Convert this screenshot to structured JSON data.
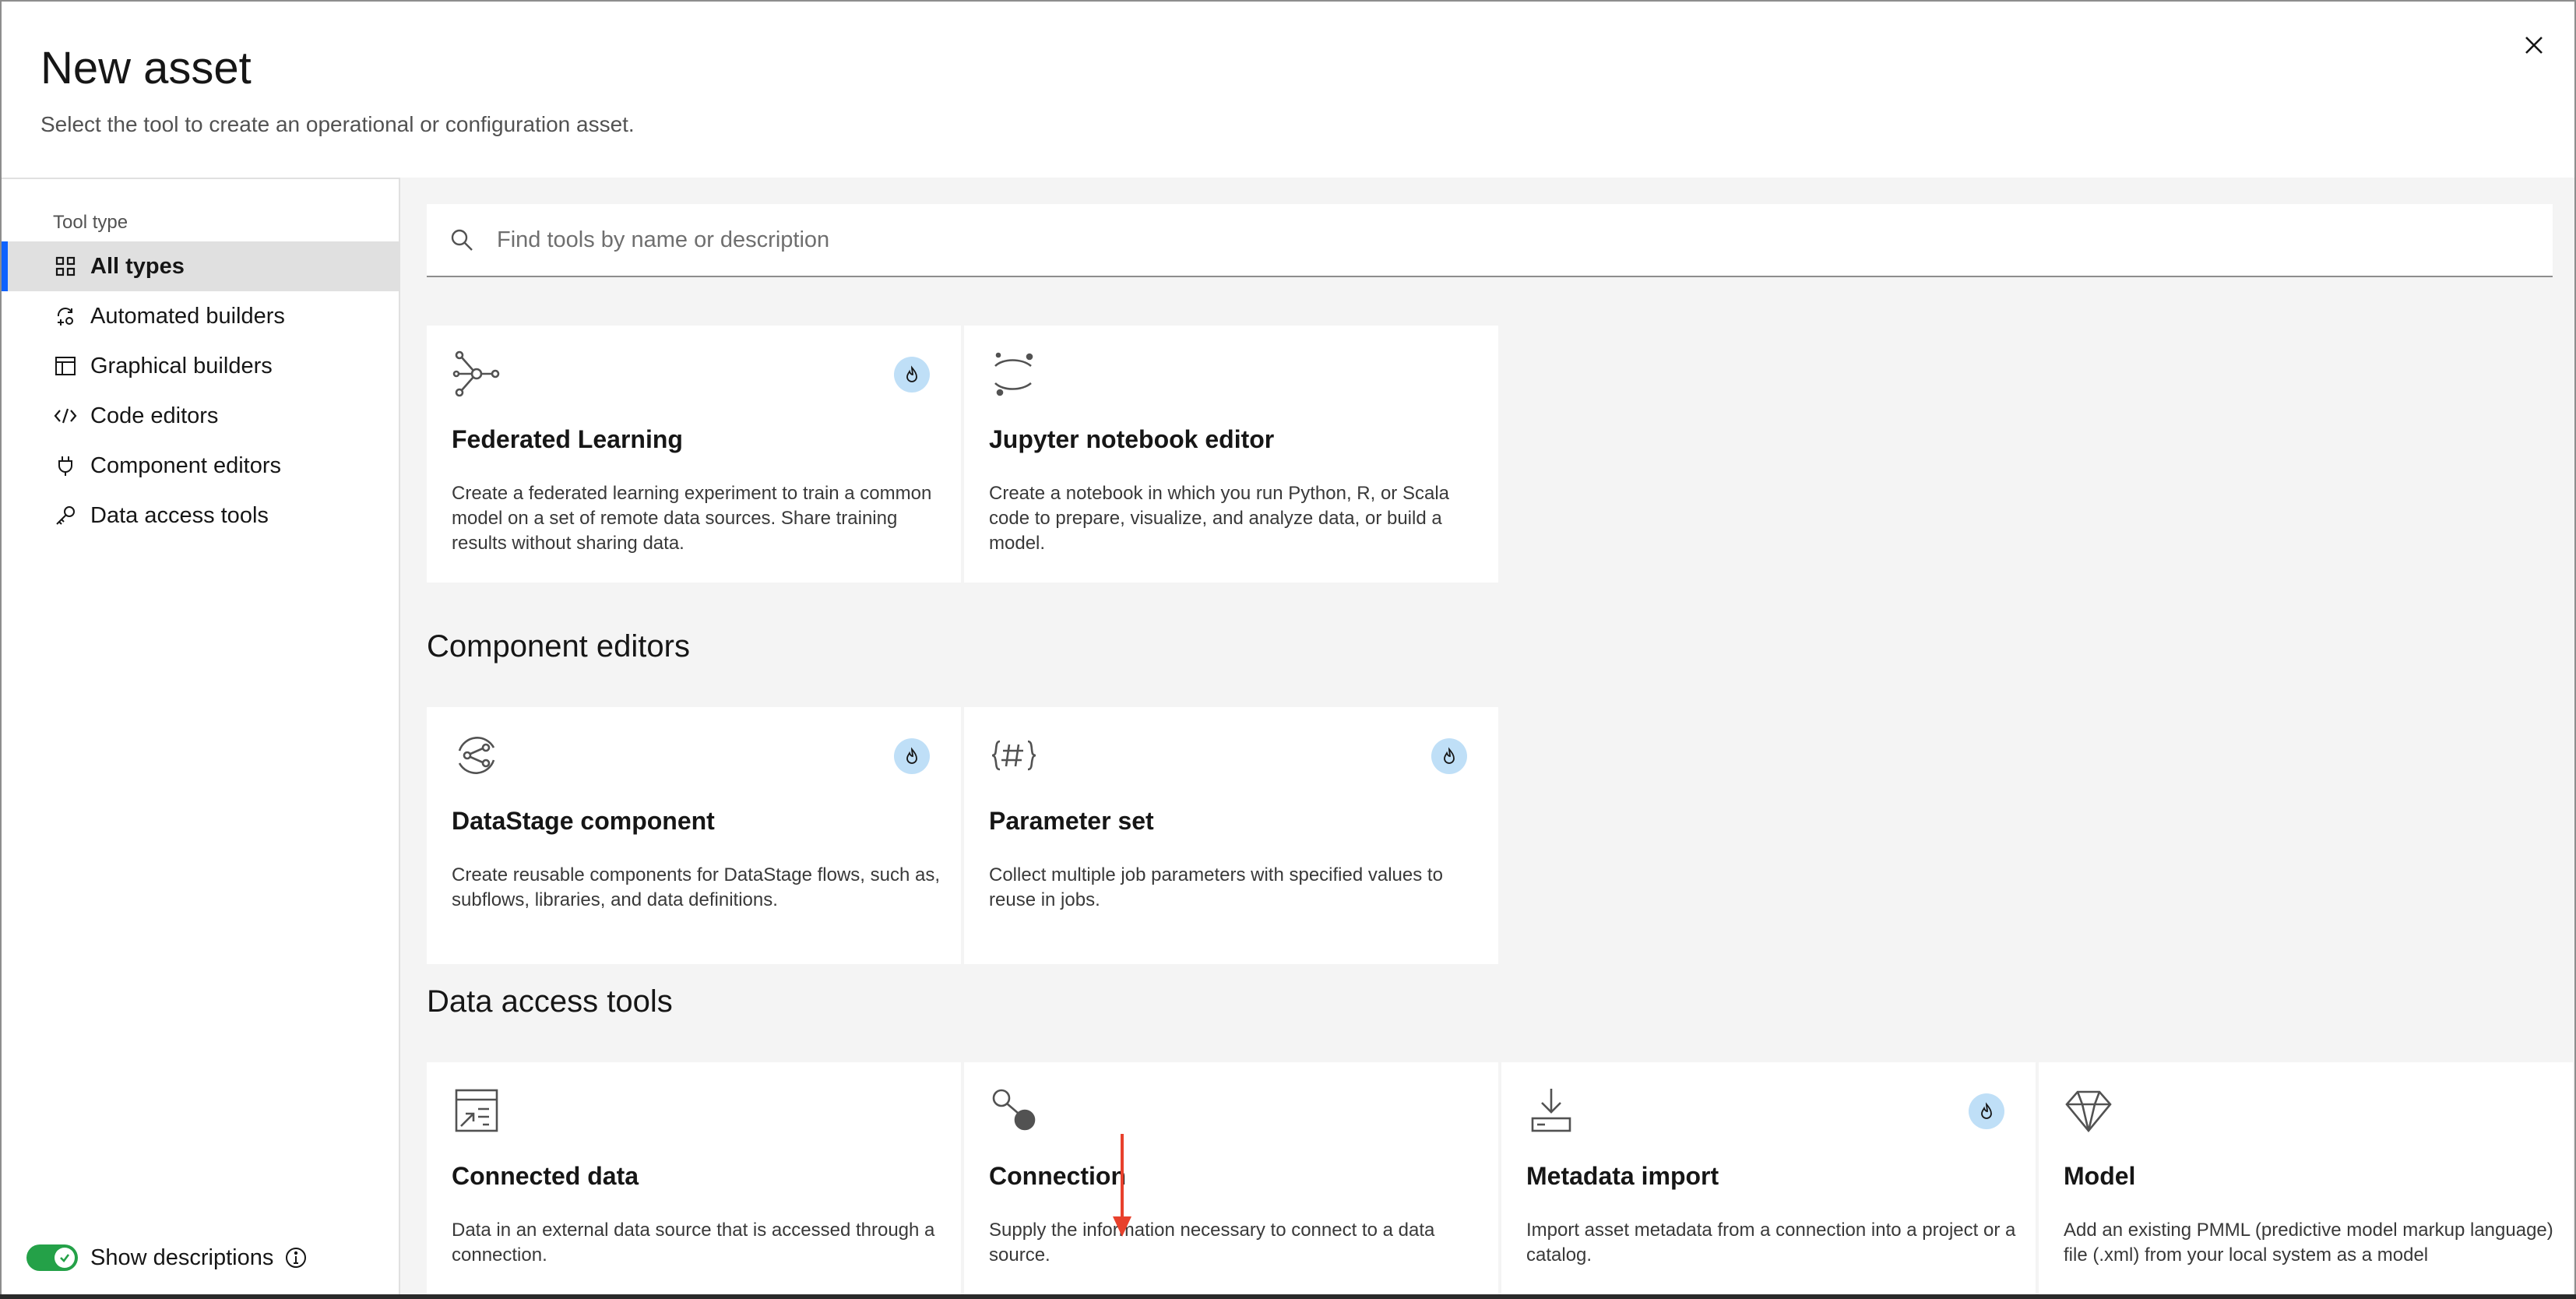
{
  "dialog": {
    "title": "New asset",
    "subtitle": "Select the tool to create an operational or configuration asset.",
    "close_icon": "close-icon"
  },
  "sidebar": {
    "heading": "Tool type",
    "items": [
      {
        "label": "All types",
        "icon": "grid-icon",
        "active": true
      },
      {
        "label": "Automated builders",
        "icon": "automated-builder-icon",
        "active": false
      },
      {
        "label": "Graphical builders",
        "icon": "graphical-builder-icon",
        "active": false
      },
      {
        "label": "Code editors",
        "icon": "code-icon",
        "active": false
      },
      {
        "label": "Component editors",
        "icon": "plug-icon",
        "active": false
      },
      {
        "label": "Data access tools",
        "icon": "key-icon",
        "active": false
      }
    ],
    "show_descriptions": {
      "label": "Show descriptions",
      "on": true
    }
  },
  "search": {
    "placeholder": "Find tools by name or description",
    "value": ""
  },
  "sections": {
    "component_editors": {
      "title": "Component editors"
    },
    "data_access_tools": {
      "title": "Data access tools"
    }
  },
  "cards": {
    "federated_learning": {
      "title": "Federated Learning",
      "description": "Create a federated learning experiment to train a common model on a set of remote data sources. Share training results without sharing data.",
      "icon": "federated-learning-icon",
      "badge": true
    },
    "jupyter": {
      "title": "Jupyter notebook editor",
      "description": "Create a notebook in which you run Python, R, or Scala code to prepare, visualize, and analyze data, or build a model.",
      "icon": "jupyter-icon",
      "badge": false
    },
    "datastage_component": {
      "title": "DataStage component",
      "description": "Create reusable components for DataStage flows, such as, subflows, libraries, and data definitions.",
      "icon": "datastage-component-icon",
      "badge": true
    },
    "parameter_set": {
      "title": "Parameter set",
      "description": "Collect multiple job parameters with specified values to reuse in jobs.",
      "icon": "parameter-set-icon",
      "badge": true
    },
    "connected_data": {
      "title": "Connected data",
      "description": "Data in an external data source that is accessed through a connection.",
      "icon": "connected-data-icon",
      "badge": false
    },
    "connection": {
      "title": "Connection",
      "description": "Supply the information necessary to connect to a data source.",
      "icon": "connection-icon",
      "badge": false
    },
    "metadata_import": {
      "title": "Metadata import",
      "description": "Import asset metadata from a connection into a project or a catalog.",
      "icon": "download-icon",
      "badge": true
    },
    "model": {
      "title": "Model",
      "description": "Add an existing PMML (predictive model markup language) file (.xml) from your local system as a model",
      "icon": "diamond-icon",
      "badge": false
    }
  },
  "colors": {
    "accent": "#0f62fe",
    "toggle_on": "#24a148",
    "badge_bg": "#bfdff7",
    "annotation_arrow": "#e8412c"
  }
}
